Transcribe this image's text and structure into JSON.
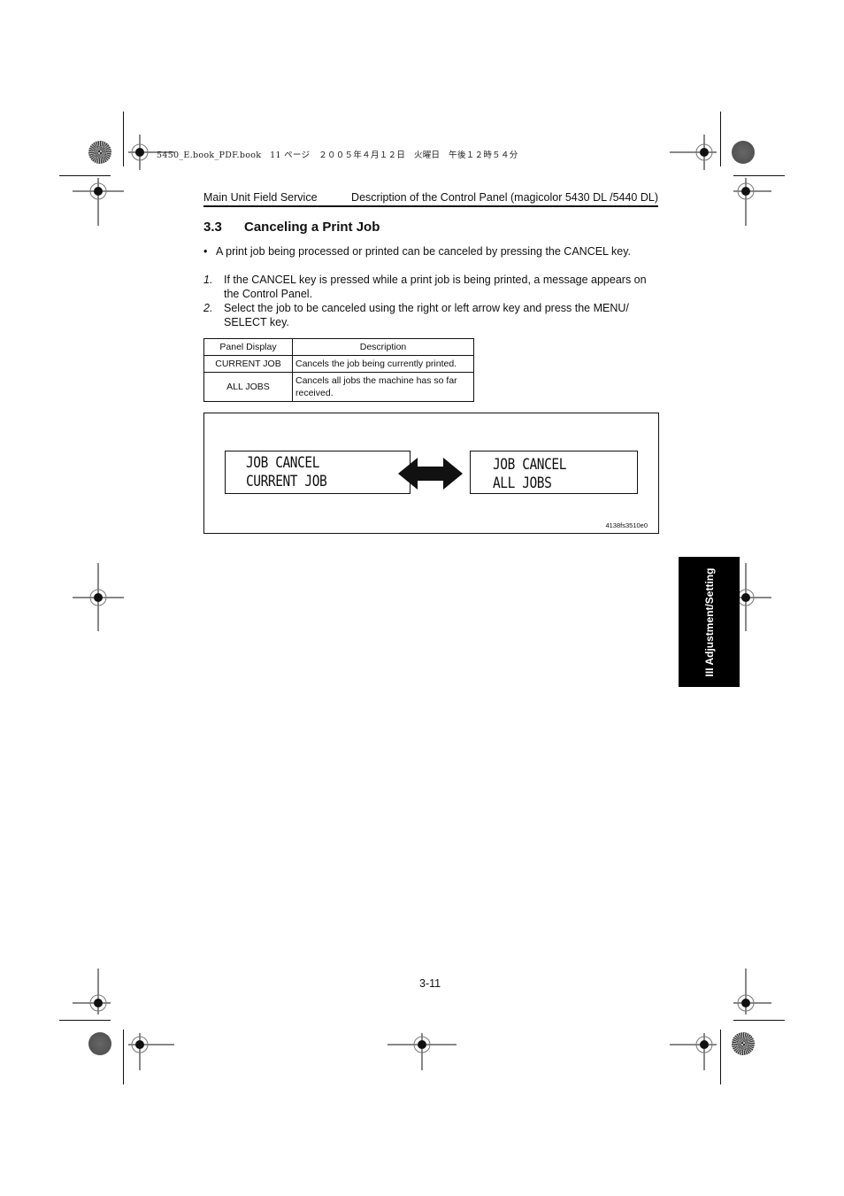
{
  "print_header": {
    "file_info": "5450_E.book_PDF.book　11 ページ　２００５年４月１２日　火曜日　午後１２時５４分"
  },
  "running_header": {
    "left": "Main Unit Field Service",
    "right": "Description of the Control Panel (magicolor 5430 DL /5440 DL)"
  },
  "section": {
    "number": "3.3",
    "title": "Canceling a Print Job"
  },
  "bullet": {
    "marker": "•",
    "text": "A print job being processed or printed can be canceled by pressing the CANCEL key."
  },
  "steps": [
    {
      "num": "1.",
      "text": "If the CANCEL key is pressed while a print job is being printed, a message appears on the Control Panel."
    },
    {
      "num": "2.",
      "text": "Select the job to be canceled using the right or left arrow key and press the MENU/ SELECT key."
    }
  ],
  "table": {
    "headers": [
      "Panel Display",
      "Description"
    ],
    "rows": [
      [
        "CURRENT JOB",
        "Cancels the job being currently printed."
      ],
      [
        "ALL JOBS",
        "Cancels all jobs the machine has so far received."
      ]
    ]
  },
  "figure": {
    "left_display": {
      "line1": "JOB CANCEL",
      "line2": "CURRENT JOB"
    },
    "right_display": {
      "line1": "JOB CANCEL",
      "line2": "ALL JOBS"
    },
    "arrow": "double-arrow-icon",
    "id": "4138fs3510e0"
  },
  "side_tab": "III Adjustment/Setting",
  "page_number": "3-11"
}
